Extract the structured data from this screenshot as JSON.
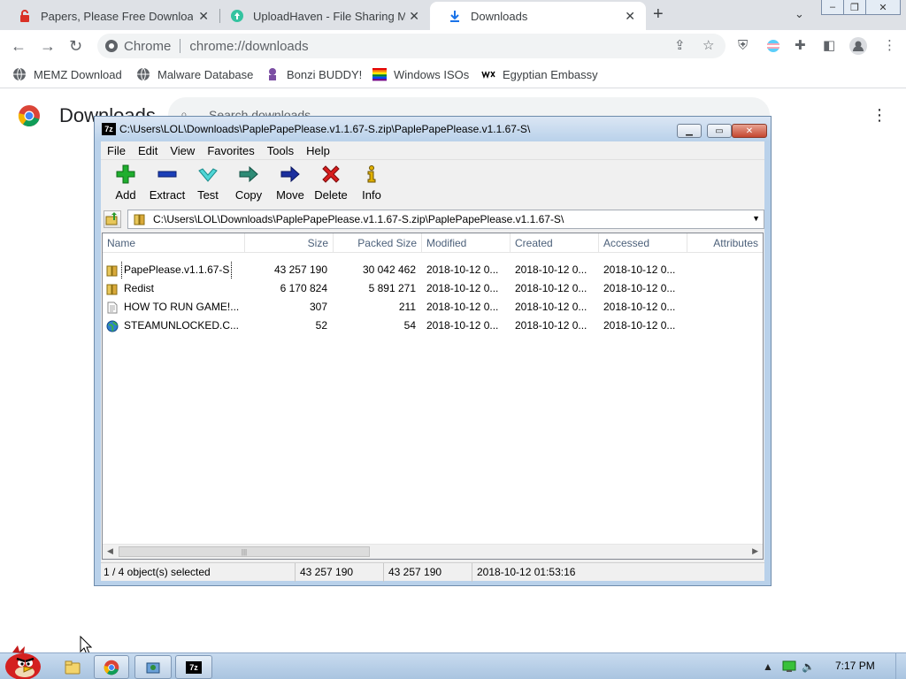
{
  "browser": {
    "tabs": [
      {
        "label": "Papers, Please Free Download",
        "favicon": "red-lock-favicon",
        "active": false
      },
      {
        "label": "UploadHaven - File Sharing M",
        "favicon": "uploadhaven-favicon",
        "active": false
      },
      {
        "label": "Downloads",
        "favicon": "download-favicon",
        "active": true
      }
    ],
    "omnibox": {
      "chip": "Chrome",
      "url": "chrome://downloads"
    },
    "bookmarks": [
      {
        "label": "MEMZ Download",
        "icon": "globe-icon"
      },
      {
        "label": "Malware Database",
        "icon": "globe-icon"
      },
      {
        "label": "Bonzi BUDDY!",
        "icon": "bonzi-icon"
      },
      {
        "label": "Windows ISOs",
        "icon": "rainbow-flag-icon"
      },
      {
        "label": "Egyptian Embassy",
        "icon": "wix-icon"
      }
    ]
  },
  "downloads_page": {
    "title": "Downloads",
    "search_placeholder": "Search downloads"
  },
  "sevenzip": {
    "title": "C:\\Users\\LOL\\Downloads\\PaplePapePlease.v1.1.67-S.zip\\PaplePapePlease.v1.1.67-S\\",
    "menu": [
      "File",
      "Edit",
      "View",
      "Favorites",
      "Tools",
      "Help"
    ],
    "toolbar": [
      {
        "label": "Add",
        "icon": "plus-icon"
      },
      {
        "label": "Extract",
        "icon": "minus-icon"
      },
      {
        "label": "Test",
        "icon": "check-icon"
      },
      {
        "label": "Copy",
        "icon": "copy-arrow-icon"
      },
      {
        "label": "Move",
        "icon": "move-arrow-icon"
      },
      {
        "label": "Delete",
        "icon": "delete-x-icon"
      },
      {
        "label": "Info",
        "icon": "info-icon"
      }
    ],
    "address": "C:\\Users\\LOL\\Downloads\\PaplePapePlease.v1.1.67-S.zip\\PaplePapePlease.v1.1.67-S\\",
    "columns": [
      "Name",
      "Size",
      "Packed Size",
      "Modified",
      "Created",
      "Accessed",
      "Attributes"
    ],
    "rows": [
      {
        "name": "PapePlease.v1.1.67-S",
        "icon": "folder-icon",
        "size": "43 257 190",
        "packed": "30 042 462",
        "modified": "2018-10-12 0...",
        "created": "2018-10-12 0...",
        "accessed": "2018-10-12 0...",
        "selected": true
      },
      {
        "name": "Redist",
        "icon": "folder-icon",
        "size": "6 170 824",
        "packed": "5 891 271",
        "modified": "2018-10-12 0...",
        "created": "2018-10-12 0...",
        "accessed": "2018-10-12 0...",
        "selected": false
      },
      {
        "name": "HOW TO RUN GAME!...",
        "icon": "text-file-icon",
        "size": "307",
        "packed": "211",
        "modified": "2018-10-12 0...",
        "created": "2018-10-12 0...",
        "accessed": "2018-10-12 0...",
        "selected": false
      },
      {
        "name": "STEAMUNLOCKED.C...",
        "icon": "internet-shortcut-icon",
        "size": "52",
        "packed": "54",
        "modified": "2018-10-12 0...",
        "created": "2018-10-12 0...",
        "accessed": "2018-10-12 0...",
        "selected": false
      }
    ],
    "status": {
      "selection": "1 / 4 object(s) selected",
      "size": "43 257 190",
      "packed": "43 257 190",
      "date": "2018-10-12 01:53:16"
    }
  },
  "taskbar": {
    "clock": "7:17 PM"
  }
}
